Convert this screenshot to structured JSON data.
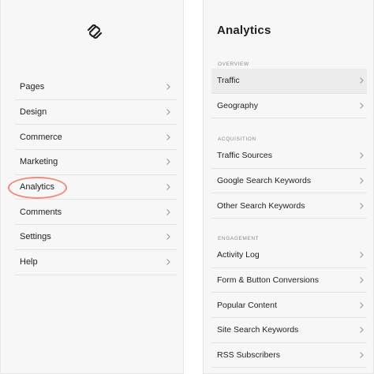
{
  "sidebar": {
    "logo_icon": "squarespace-logo-icon",
    "items": [
      {
        "label": "Pages"
      },
      {
        "label": "Design"
      },
      {
        "label": "Commerce"
      },
      {
        "label": "Marketing"
      },
      {
        "label": "Analytics",
        "highlighted": true
      },
      {
        "label": "Comments"
      },
      {
        "label": "Settings"
      },
      {
        "label": "Help"
      }
    ],
    "highlight_color": "#f08a7a"
  },
  "analytics": {
    "title": "Analytics",
    "sections": [
      {
        "label": "OVERVIEW",
        "items": [
          {
            "label": "Traffic",
            "active": true
          },
          {
            "label": "Geography"
          }
        ]
      },
      {
        "label": "ACQUISITION",
        "items": [
          {
            "label": "Traffic Sources"
          },
          {
            "label": "Google Search Keywords"
          },
          {
            "label": "Other Search Keywords"
          }
        ]
      },
      {
        "label": "ENGAGEMENT",
        "items": [
          {
            "label": "Activity Log"
          },
          {
            "label": "Form & Button Conversions"
          },
          {
            "label": "Popular Content"
          },
          {
            "label": "Site Search Keywords"
          },
          {
            "label": "RSS Subscribers"
          }
        ]
      }
    ]
  },
  "colors": {
    "panel_bg": "#f7f7f7",
    "active_row_bg": "#ececec",
    "divider": "#e4e4e4",
    "text": "#222222",
    "section_label": "#888888"
  }
}
